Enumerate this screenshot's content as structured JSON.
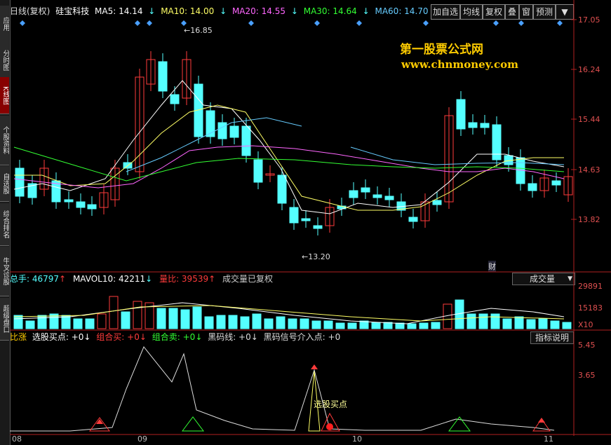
{
  "left_tabs": [
    {
      "label": "应用",
      "active": false
    },
    {
      "label": "分时图",
      "active": false
    },
    {
      "label": "K线图",
      "active": true
    },
    {
      "label": "个股资料",
      "active": false
    },
    {
      "label": "自选股",
      "active": false
    },
    {
      "label": "综合排名",
      "active": false
    },
    {
      "label": "牛叉诊股",
      "active": false
    },
    {
      "label": "超级盘口",
      "active": false
    }
  ],
  "info": {
    "period": "日线(复权)",
    "stock": "硅宝科技",
    "ma5": "MA5: 14.14",
    "ma10": "MA10: 14.00",
    "ma20": "MA20: 14.55",
    "ma30": "MA30: 14.64",
    "ma60": "MA60: 14.70"
  },
  "toolbar": {
    "add_fav": "加自选",
    "ma_line": "均线",
    "restore": "复权",
    "overlay": "叠",
    "window": "窗",
    "forecast": "预测"
  },
  "watermark": {
    "title": "第一股票公式网",
    "url": "www.chnmoney.com"
  },
  "price_axis": [
    "17.05",
    "16.24",
    "15.44",
    "14.63",
    "13.82"
  ],
  "annotations": {
    "high": "16.85",
    "low": "13.20",
    "finance": "财"
  },
  "volume_bar": {
    "total": "总手: 46797",
    "mavol": "MAVOL10: 42211",
    "ratio": "量比: 39539",
    "restored": "成交量已复权",
    "dropdown": "成交量"
  },
  "volume_axis": [
    "29891",
    "15183",
    "X10"
  ],
  "indicator_bar": {
    "name": "比涨",
    "buy": "选股买点: +0",
    "combo_buy": "组合买: +0",
    "combo_sell": "组合卖: +0",
    "black_line": "黑码线: +0",
    "black_signal": "黑码信号介入点: +0",
    "help": "指标说明"
  },
  "indicator_axis": [
    "5.45",
    "3.65"
  ],
  "indicator_label": "选股买点",
  "dates": [
    "08",
    "09",
    "10",
    "11"
  ],
  "colors": {
    "up": "#ff3b3b",
    "down": "#54ffff",
    "ma5": "#ffffff",
    "ma10": "#ffff66",
    "ma20": "#ff66ff",
    "ma30": "#33ff33",
    "ma60": "#66ccff",
    "axis": "#b02020"
  }
}
